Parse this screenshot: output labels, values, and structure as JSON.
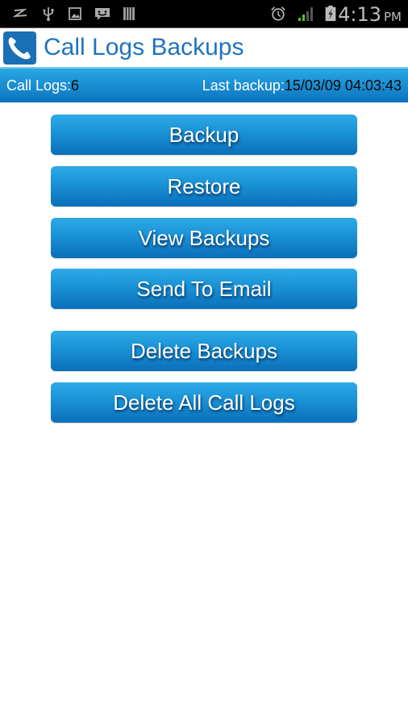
{
  "status_bar": {
    "left_icons": [
      "notification-z-icon",
      "usb-icon",
      "gallery-icon",
      "message-icon",
      "barcode-icon"
    ],
    "right_icons": [
      "alarm-icon",
      "signal-icon",
      "battery-charging-icon"
    ],
    "time": "4:13",
    "ampm": "PM"
  },
  "titlebar": {
    "icon": "phone-icon",
    "title": "Call Logs Backups"
  },
  "infobar": {
    "call_logs_label": "Call Logs:",
    "call_logs_count": "6",
    "last_backup_label": "Last backup:",
    "last_backup_value": "15/03/09 04:03:43"
  },
  "buttons": [
    {
      "label": "Backup"
    },
    {
      "label": "Restore"
    },
    {
      "label": "View Backups"
    },
    {
      "label": "Send To Email"
    },
    {
      "label": "Delete Backups"
    },
    {
      "label": "Delete All Call Logs"
    }
  ],
  "colors": {
    "accent": "#1f73bf",
    "button_top": "#2eaae6",
    "button_bottom": "#0a6fba"
  }
}
